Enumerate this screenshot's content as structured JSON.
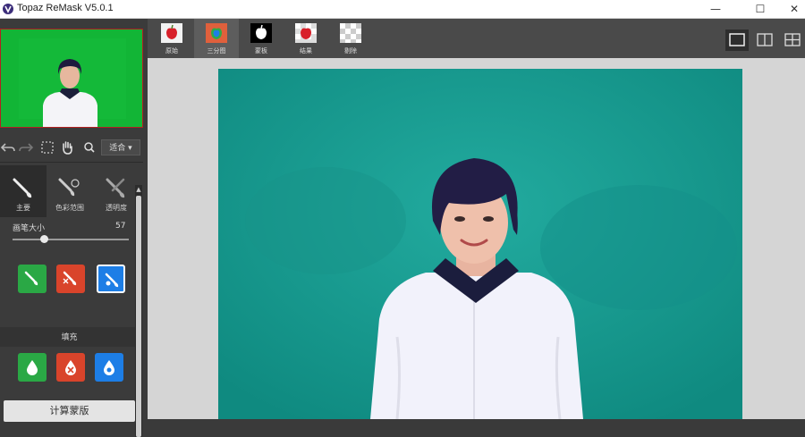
{
  "window": {
    "title": "Topaz ReMask V5.0.1",
    "controls": [
      "—",
      "☐",
      "✕"
    ]
  },
  "toolbar": {
    "fit_dropdown": "适合 ▾"
  },
  "brush_tabs": [
    {
      "label": "主要",
      "active": true
    },
    {
      "label": "色彩范围",
      "active": false
    },
    {
      "label": "透明度",
      "active": false
    }
  ],
  "brush": {
    "size_label": "画笔大小",
    "size_value": "57",
    "size_fraction": 0.27
  },
  "mask_buttons": [
    {
      "name": "keep",
      "color": "#2aa845",
      "selected": false
    },
    {
      "name": "drop",
      "color": "#d9442b",
      "selected": false
    },
    {
      "name": "compute",
      "color": "#1d7ee6",
      "selected": true
    }
  ],
  "fill": {
    "section_label": "填充",
    "buttons": [
      {
        "name": "keep-fill",
        "color": "#2aa845"
      },
      {
        "name": "drop-fill",
        "color": "#d9442b"
      },
      {
        "name": "compute-fill",
        "color": "#1d7ee6"
      }
    ]
  },
  "compute_mask_label": "计算蒙版",
  "view_tabs": [
    {
      "label": "原始",
      "active": false
    },
    {
      "label": "三分图",
      "active": true
    },
    {
      "label": "蒙板",
      "active": false
    },
    {
      "label": "结果",
      "active": false
    },
    {
      "label": "剔除",
      "active": false
    }
  ],
  "layout_buttons": [
    "single",
    "split",
    "quad"
  ],
  "colors": {
    "accent_blue": "#1d7ee6",
    "keep_green": "#2aa845",
    "drop_red": "#d9442b",
    "photo_background": "#169a90",
    "preview_background": "#12b536"
  }
}
